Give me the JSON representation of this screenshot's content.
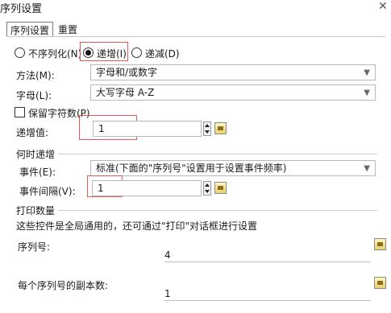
{
  "window": {
    "title": "序列设置",
    "close_glyph": "✕"
  },
  "tabs": [
    {
      "label": "序列设置",
      "active": true
    },
    {
      "label": "重置",
      "active": false
    }
  ],
  "mode": {
    "options": [
      {
        "label": "不序列化(N)",
        "selected": false
      },
      {
        "label": "递增(I)",
        "selected": true
      },
      {
        "label": "递减(D)",
        "selected": false
      }
    ]
  },
  "method": {
    "label": "方法(M):",
    "value": "字母和/或数字"
  },
  "letters": {
    "label": "字母(L):",
    "value": "大写字母 A-Z"
  },
  "keep_chars": {
    "label": "保留字符数(P)",
    "checked": false
  },
  "increment": {
    "label": "递增值:",
    "value": "1"
  },
  "when_increment": {
    "title": "何时递增",
    "event_label": "事件(E):",
    "event_value": "标准(下面的\"序列号\"设置用于设置事件频率)",
    "interval_label": "事件间隔(V):",
    "interval_value": "1"
  },
  "print_count": {
    "title": "打印数量",
    "description": "这些控件是全局通用的，还可通过\"打印\"对话框进行设置",
    "serial_label": "序列号:",
    "serial_value": "4",
    "copies_label": "每个序列号的副本数:",
    "copies_value": "1"
  },
  "colors": {
    "highlight": "#e05a5a"
  }
}
